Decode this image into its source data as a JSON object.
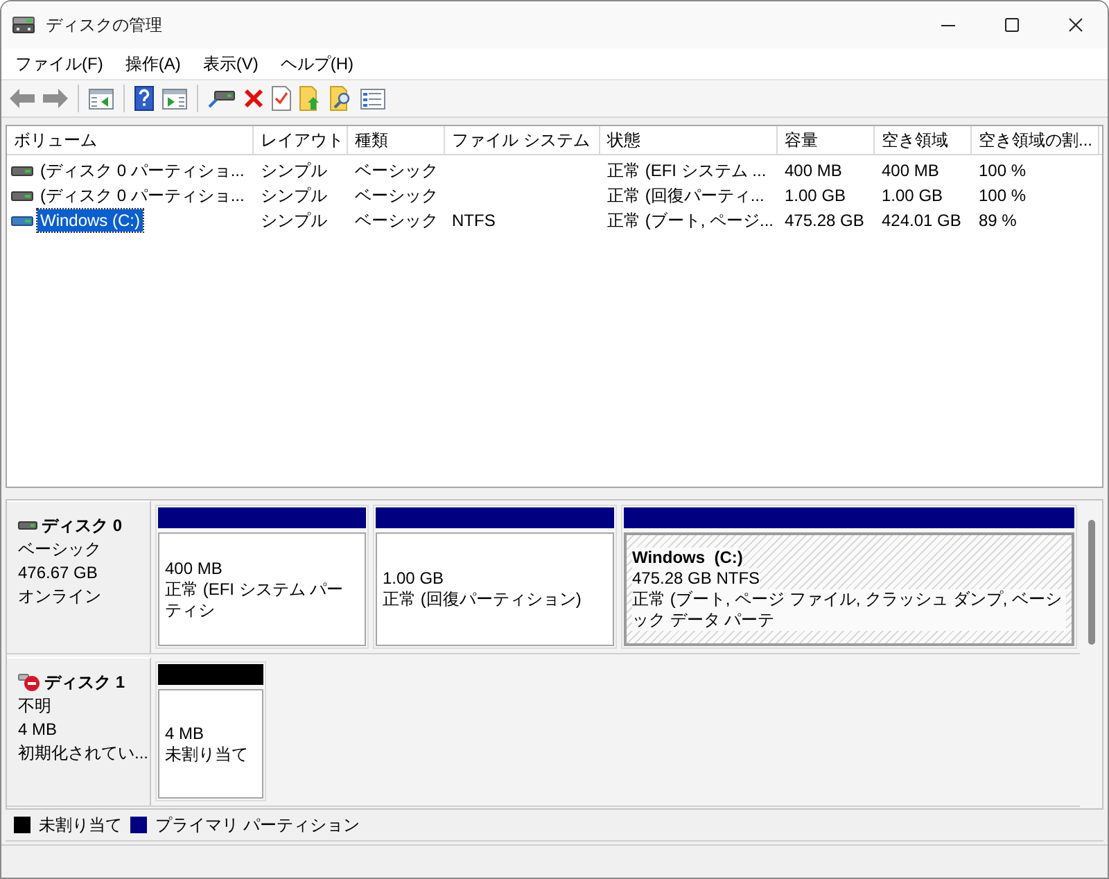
{
  "window": {
    "title": "ディスクの管理"
  },
  "menu": [
    {
      "label": "ファイル(F)"
    },
    {
      "label": "操作(A)"
    },
    {
      "label": "表示(V)"
    },
    {
      "label": "ヘルプ(H)"
    }
  ],
  "volume_list": {
    "columns": [
      "ボリューム",
      "レイアウト",
      "種類",
      "ファイル システム",
      "状態",
      "容量",
      "空き領域",
      "空き領域の割..."
    ],
    "rows": [
      {
        "volume": "(ディスク 0 パーティショ...",
        "layout": "シンプル",
        "type": "ベーシック",
        "status": "正常 (EFI システム ...",
        "capacity": "400 MB",
        "free_space": "400 MB",
        "percent_free": "100 %",
        "selected": false
      },
      {
        "volume": "(ディスク 0 パーティショ...",
        "layout": "シンプル",
        "type": "ベーシック",
        "status": "正常 (回復パーティ...",
        "capacity": "1.00 GB",
        "free_space": "1.00 GB",
        "percent_free": "100 %",
        "selected": false
      },
      {
        "volume": "Windows (C:)",
        "layout": "シンプル",
        "type": "ベーシック",
        "file_system": "NTFS",
        "status": "正常 (ブート, ページ...",
        "capacity": "475.28 GB",
        "free_space": "424.01 GB",
        "percent_free": "89 %",
        "selected": true
      }
    ]
  },
  "disks": [
    {
      "name": "ディスク 0",
      "kind": "basic",
      "type": "ベーシック",
      "size": "476.67 GB",
      "status": "オンライン",
      "partitions": [
        {
          "color": "#000080",
          "size": "400 MB",
          "status": "正常 (EFI システム パーティシ",
          "selected": false
        },
        {
          "color": "#000080",
          "size": "1.00 GB",
          "status": "正常 (回復パーティション)",
          "selected": false
        },
        {
          "color": "#000080",
          "name": "Windows  (C:)",
          "size": "475.28 GB NTFS",
          "status": "正常 (ブート, ページ ファイル, クラッシュ ダンプ, ベーシック データ パーテ",
          "selected": true
        }
      ]
    },
    {
      "name": "ディスク 1",
      "kind": "uninitialized",
      "type": "不明",
      "size": "4 MB",
      "status": "初期化されてい...",
      "partitions": [
        {
          "color": "#000000",
          "size": "4 MB",
          "status": "未割り当て",
          "selected": false
        }
      ]
    }
  ],
  "legend": [
    {
      "label": "未割り当て",
      "color": "#000000"
    },
    {
      "label": "プライマリ パーティション",
      "color": "#000080"
    }
  ]
}
